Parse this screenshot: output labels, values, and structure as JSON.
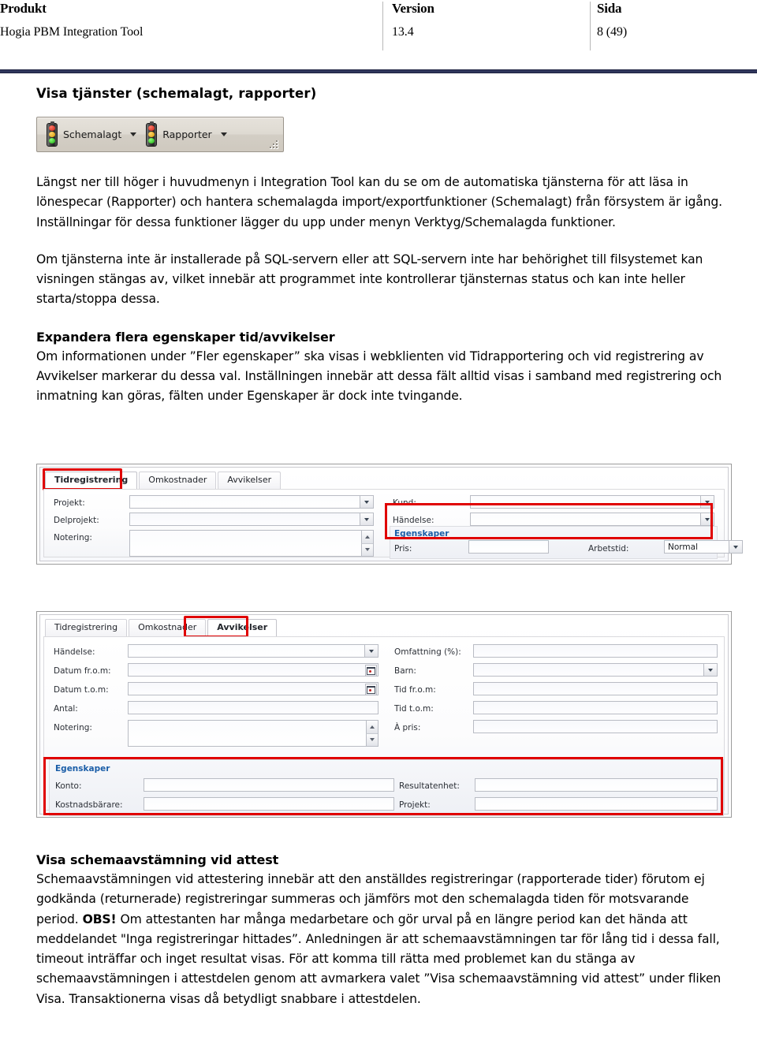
{
  "header": {
    "columns": [
      {
        "title": "Produkt",
        "value": "Hogia PBM Integration Tool"
      },
      {
        "title": "Version",
        "value": "13.4"
      },
      {
        "title": "Sida",
        "value": "8 (49)"
      }
    ]
  },
  "section1": {
    "heading": "Visa tjänster (schemalagt, rapporter)",
    "toolbar": {
      "buttons": [
        {
          "icon": "traffic-light-icon",
          "label": "Schemalagt",
          "caret": "▾"
        },
        {
          "icon": "traffic-light-icon",
          "label": "Rapporter",
          "caret": "▾"
        }
      ]
    },
    "paragraph1": "Längst ner till höger i huvudmenyn i Integration Tool kan du se om de automatiska tjänsterna för att läsa in lönespecar (Rapporter) och hantera schemalagda import/exportfunktioner (Schemalagt) från försystem är igång. Inställningar för dessa funktioner lägger du upp under menyn Verktyg/Schemalagda funktioner.",
    "paragraph2": "Om tjänsterna inte är installerade på SQL-servern eller att SQL-servern inte har behörighet till filsystemet kan visningen stängas av, vilket innebär att programmet inte kontrollerar tjänsternas status och kan inte heller starta/stoppa dessa."
  },
  "section2": {
    "heading": "Expandera flera egenskaper tid/avvikelser",
    "paragraph1": "Om informationen under ”Fler egenskaper” ska visas i webklienten vid Tidrapportering och vid registrering av Avvikelser markerar du dessa val. Inställningen innebär att dessa fält alltid visas i samband med registrering och inmatning kan göras, fälten under Egenskaper är dock inte tvingande."
  },
  "form1": {
    "tabs": [
      {
        "label": "Tidregistrering",
        "active": true,
        "highlighted": true
      },
      {
        "label": "Omkostnader",
        "active": false,
        "highlighted": false
      },
      {
        "label": "Avvikelser",
        "active": false,
        "highlighted": false
      }
    ],
    "left_fields": [
      {
        "label": "Projekt:",
        "type": "combobox",
        "value": ""
      },
      {
        "label": "Delprojekt:",
        "type": "combobox",
        "value": ""
      },
      {
        "label": "Notering:",
        "type": "textarea-spinner",
        "value": ""
      }
    ],
    "right_fields": [
      {
        "label": "Kund:",
        "type": "combobox",
        "value": ""
      },
      {
        "label": "Händelse:",
        "type": "combobox",
        "value": ""
      }
    ],
    "group": {
      "title": "Egenskaper",
      "highlighted": true,
      "fields": [
        {
          "label": "Pris:",
          "type": "text",
          "value": ""
        },
        {
          "label": "Arbetstid:",
          "type": "combobox",
          "value": "Normal"
        }
      ]
    }
  },
  "form2": {
    "tabs": [
      {
        "label": "Tidregistrering",
        "active": false,
        "highlighted": false
      },
      {
        "label": "Omkostnader",
        "active": false,
        "highlighted": false
      },
      {
        "label": "Avvikelser",
        "active": true,
        "highlighted": true
      }
    ],
    "left_fields": [
      {
        "label": "Händelse:",
        "type": "combobox",
        "value": ""
      },
      {
        "label": "Datum fr.o.m:",
        "type": "datepicker",
        "value": ""
      },
      {
        "label": "Datum t.o.m:",
        "type": "datepicker",
        "value": ""
      },
      {
        "label": "Antal:",
        "type": "text",
        "value": ""
      },
      {
        "label": "Notering:",
        "type": "textarea-spinner",
        "value": ""
      }
    ],
    "right_fields": [
      {
        "label": "Omfattning (%):",
        "type": "text",
        "value": ""
      },
      {
        "label": "Barn:",
        "type": "combobox",
        "value": ""
      },
      {
        "label": "Tid fr.o.m:",
        "type": "text",
        "value": ""
      },
      {
        "label": "Tid t.o.m:",
        "type": "text",
        "value": ""
      },
      {
        "label": "À pris:",
        "type": "text",
        "value": ""
      }
    ],
    "group": {
      "title": "Egenskaper",
      "highlighted": true,
      "left_fields": [
        {
          "label": "Konto:",
          "type": "text",
          "value": ""
        },
        {
          "label": "Kostnadsbärare:",
          "type": "text",
          "value": ""
        }
      ],
      "right_fields": [
        {
          "label": "Resultatenhet:",
          "type": "text",
          "value": ""
        },
        {
          "label": "Projekt:",
          "type": "text",
          "value": ""
        }
      ]
    }
  },
  "section3": {
    "heading": "Visa schemaavstämning vid attest",
    "paragraph_part1": "Schemaavstämningen vid attestering innebär att den anställdes registreringar (rapporterade tider) förutom ej godkända (returnerade) registreringar summeras och jämförs mot den schemalagda tiden för motsvarande period. ",
    "paragraph_bold": "OBS!",
    "paragraph_part2": " Om attestanten har många medarbetare och gör urval på en längre period kan det hända att meddelandet \"Inga registreringar hittades”. Anledningen är att schemaavstämningen tar för lång tid i dessa fall, timeout inträffar och inget resultat visas. För att komma till rätta med problemet kan du stänga av schemaavstämningen i attestdelen genom att avmarkera valet ”Visa schemaavstämning vid attest” under fliken Visa. Transaktionerna visas då betydligt snabbare i attestdelen."
  },
  "colors": {
    "rule": "#30365c",
    "highlight": "#e00000",
    "group_title": "#1b5ea8"
  }
}
